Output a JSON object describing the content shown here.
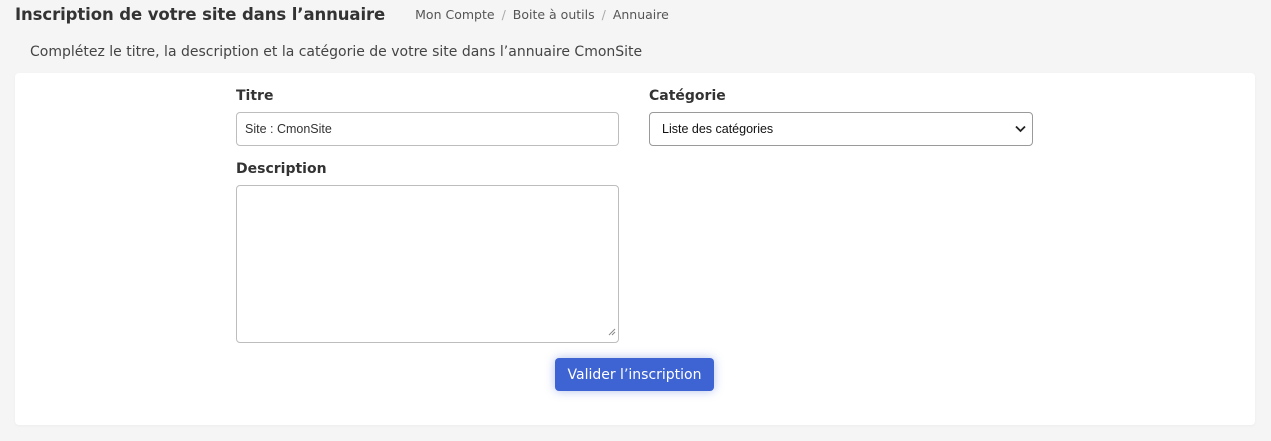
{
  "header": {
    "title": "Inscription de votre site dans l’annuaire",
    "breadcrumb": [
      "Mon Compte",
      "Boite à outils",
      "Annuaire"
    ]
  },
  "intro": "Complétez le titre, la description et la catégorie de votre site dans l’annuaire CmonSite",
  "form": {
    "title_label": "Titre",
    "title_value": "Site : CmonSite",
    "category_label": "Catégorie",
    "category_selected": "Liste des catégories",
    "description_label": "Description",
    "description_value": "",
    "submit_label": "Valider l’inscription"
  },
  "colors": {
    "primary_button": "#3e63d3",
    "page_background": "#f5f5f5",
    "card_background": "#ffffff"
  },
  "icons": {
    "select_arrow": "chevron-down-icon",
    "textarea_resize": "resize-grip-icon"
  }
}
